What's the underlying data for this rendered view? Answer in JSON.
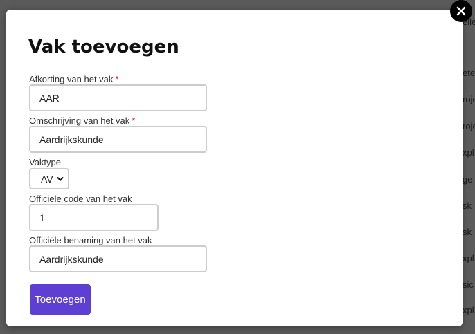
{
  "background": {
    "words": [
      "elle",
      "ete",
      "roje",
      "roje",
      "xpl",
      "ge",
      "sk",
      "sk",
      "xpl",
      "sic",
      "xpl"
    ]
  },
  "modal": {
    "title": "Vak toevoegen",
    "close_icon": "close-icon",
    "fields": {
      "afkorting": {
        "label": "Afkorting van het vak",
        "required_mark": "*",
        "value": "AAR"
      },
      "omschrijving": {
        "label": "Omschrijving van het vak",
        "required_mark": "*",
        "value": "Aardrijkskunde"
      },
      "vaktype": {
        "label": "Vaktype",
        "selected": "AV"
      },
      "code": {
        "label": "Officiële code van het vak",
        "value": "1"
      },
      "benaming": {
        "label": "Officiële benaming van het vak",
        "value": "Aardrijkskunde"
      }
    },
    "submit_label": "Toevoegen"
  },
  "colors": {
    "accent": "#5d3fd3",
    "required": "#e02424",
    "overlay": "#5a5a5a"
  }
}
